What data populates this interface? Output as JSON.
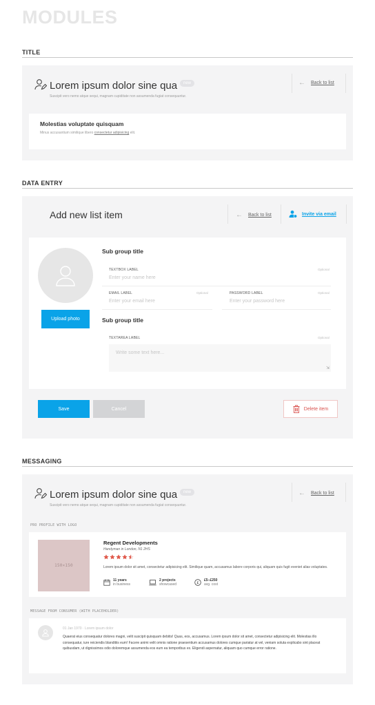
{
  "page": {
    "title": "MODULES"
  },
  "sections": {
    "title": "TITLE",
    "data_entry": "DATA ENTRY",
    "messaging": "MESSAGING"
  },
  "title_module": {
    "heading": "Lorem ipsum dolor sine qua",
    "badge": "new",
    "subtitle": "Suscipit vero nemo atque sequi, magnam cupiditate non assumenda fugiat consequuntur.",
    "back_label": "Back to list",
    "card": {
      "title": "Molestias voluptate quisquam",
      "text_before": "Minus accusantium similique libero ",
      "link": "consectetur adipisicing",
      "text_after": " elit."
    }
  },
  "data_entry": {
    "heading": "Add new list item",
    "back_label": "Back to list",
    "invite_label": "Invite via email",
    "upload_label": "Upload photo",
    "group1_title": "Sub group title",
    "group2_title": "Sub group title",
    "textbox": {
      "label": "TEXTBOX LABEL",
      "optional": "Optional",
      "placeholder": "Enter your name here"
    },
    "email": {
      "label": "EMAIL LABEL",
      "optional": "Optional",
      "placeholder": "Enter your email here"
    },
    "password": {
      "label": "PASSWORD LABEL",
      "optional": "Optional",
      "placeholder": "Enter your password here"
    },
    "textarea": {
      "label": "TEXTAREA LABEL",
      "optional": "Optional",
      "placeholder": "Write some text here..."
    },
    "save_label": "Save",
    "cancel_label": "Cancel",
    "delete_label": "Delete item"
  },
  "messaging": {
    "heading": "Lorem ipsum dolor sine qua",
    "badge": "new",
    "subtitle": "Suscipit vero nemo atque sequi, magnam cupiditate non assumenda fugiat consequuntur.",
    "back_label": "Back to list",
    "profile_caption": "PRO PROFILE WITH LOGO",
    "profile": {
      "logo_placeholder": "150×150",
      "name": "Regent Developments",
      "location": "Handyman in London, N1 2HS",
      "rating": 4.5,
      "rating_max": 5,
      "description": "Lorem ipsum dolor sit amet, consectetur adipisicing elit. Similique quam, accusamus labore corporis qui, aliquam quis fugit eveniet alias voluptates.",
      "stats": [
        {
          "value": "11 years",
          "label": "in business",
          "icon": "calendar-icon"
        },
        {
          "value": "2 projects",
          "label": "showcased",
          "icon": "laptop-icon"
        },
        {
          "value": "£5–£250",
          "label": "avg. cost",
          "icon": "pound-icon"
        }
      ]
    },
    "message_caption": "MESSAGE FROM CONSUMER (WITH PLACEHOLDER)",
    "message": {
      "meta": "01 Jan 1970 · Lorem ipsum dolor",
      "body": "Quaerat eius consequatur dolores magni, velit suscipit quisquam debitis! Quas, eos, accusamus. Lorem ipsum dolor sit amet, consectetur adipisicing elit. Molestias illo consequatur, iure reiciendis blanditiis eum! Facere animi velit omnis ratione praesentium accusamus dolores cumque pariatur at vel, veniam soluta explicabo sint placeat quibusdam, ut dignissimos odio doloremque assumenda eos eum ea temporibus ex. Eligendi aspernatur, aliquam quo cumque error ratione."
    }
  },
  "colors": {
    "primary": "#0aa3e8",
    "danger": "#d9534f",
    "star": "#e05a4c",
    "logo_bg": "#dcc6c6"
  }
}
